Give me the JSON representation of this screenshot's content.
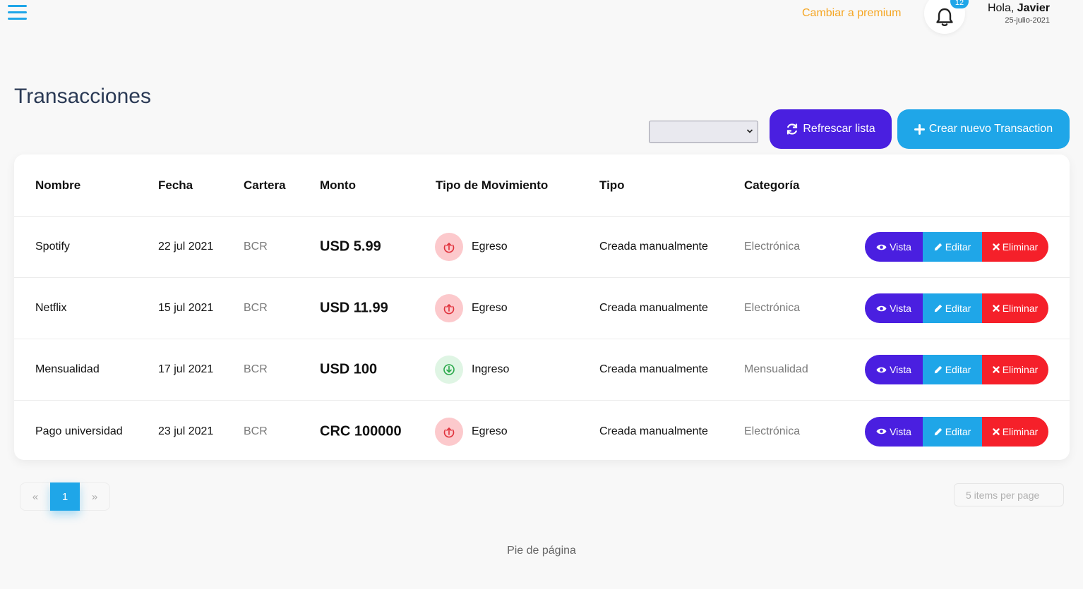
{
  "header": {
    "premium_label": "Cambiar a premium",
    "notifications_count": "12",
    "greeting_prefix": "Hola, ",
    "user_name": "Javier",
    "date": "25-julio-2021"
  },
  "page": {
    "title": "Transacciones",
    "filter_value": "",
    "refresh_label": "Refrescar lista",
    "create_label": "Crear nuevo Transaction"
  },
  "table": {
    "columns": [
      "Nombre",
      "Fecha",
      "Cartera",
      "Monto",
      "Tipo de Movimiento",
      "Tipo",
      "Categoría"
    ],
    "rows": [
      {
        "name": "Spotify",
        "date": "22 jul 2021",
        "wallet": "BCR",
        "amount": "USD 5.99",
        "movement": "Egreso",
        "type": "Creada manualmente",
        "category": "Electrónica"
      },
      {
        "name": "Netflix",
        "date": "15 jul 2021",
        "wallet": "BCR",
        "amount": "USD 11.99",
        "movement": "Egreso",
        "type": "Creada manualmente",
        "category": "Electrónica"
      },
      {
        "name": "Mensualidad",
        "date": "17 jul 2021",
        "wallet": "BCR",
        "amount": "USD 100",
        "movement": "Ingreso",
        "type": "Creada manualmente",
        "category": "Mensualidad"
      },
      {
        "name": "Pago universidad",
        "date": "23 jul 2021",
        "wallet": "BCR",
        "amount": "CRC 100000",
        "movement": "Egreso",
        "type": "Creada manualmente",
        "category": "Electrónica"
      }
    ],
    "actions": {
      "view": "Vista",
      "edit": "Editar",
      "delete": "Eliminar"
    }
  },
  "pagination": {
    "prev": "«",
    "current": "1",
    "next": "»",
    "per_page": "5 items per page"
  },
  "footer": {
    "text": "Pie de página"
  },
  "colors": {
    "primary_purple": "#4a1fe0",
    "accent_blue": "#1fa6e8",
    "danger_red": "#f5202a",
    "premium_orange": "#f5a623"
  }
}
